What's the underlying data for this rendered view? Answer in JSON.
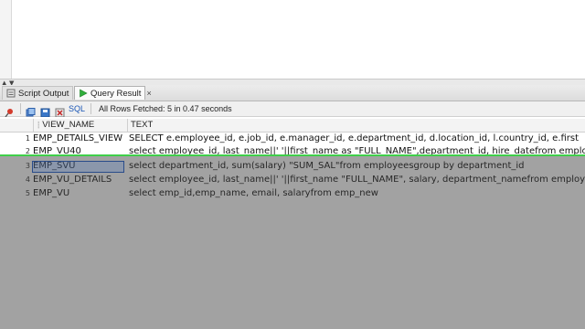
{
  "tabs": [
    {
      "label": "Script Output",
      "icon": "script-output-icon"
    },
    {
      "label": "Query Result",
      "icon": "run-query-icon"
    }
  ],
  "tab_close": "×",
  "toolbar": {
    "icons": [
      "pin-icon",
      "refresh-icon",
      "export-icon",
      "delete-icon"
    ],
    "sql_label": "SQL",
    "status": "All Rows Fetched: 5 in 0.47 seconds"
  },
  "grid": {
    "columns": [
      "VIEW_NAME",
      "TEXT"
    ],
    "rows": [
      {
        "num": "1",
        "view_name": "EMP_DETAILS_VIEW",
        "text": "SELECT  e.employee_id,  e.job_id,  e.manager_id,  e.department_id,  d.location_id,  l.country_id,  e.first"
      },
      {
        "num": "2",
        "view_name": "EMP_VU40",
        "text": "select employee_id, last_name||' '||first_name as \"FULL_NAME\",department_id, hire_datefrom emplo"
      },
      {
        "num": "3",
        "view_name": "EMP_SVU",
        "text": "select department_id, sum(salary) \"SUM_SAL\"from employeesgroup by department_id"
      },
      {
        "num": "4",
        "view_name": "EMP_VU_DETAILS",
        "text": "select employee_id, last_name||' '||first_name \"FULL_NAME\", salary, department_namefrom employe"
      },
      {
        "num": "5",
        "view_name": "EMP_VU",
        "text": "select emp_id,emp_name, email, salaryfrom emp_new"
      }
    ]
  },
  "colors": {
    "highlight_line": "#3fcf4a",
    "selection_border": "#2a4c8a",
    "sql_text": "#1a56b5"
  }
}
